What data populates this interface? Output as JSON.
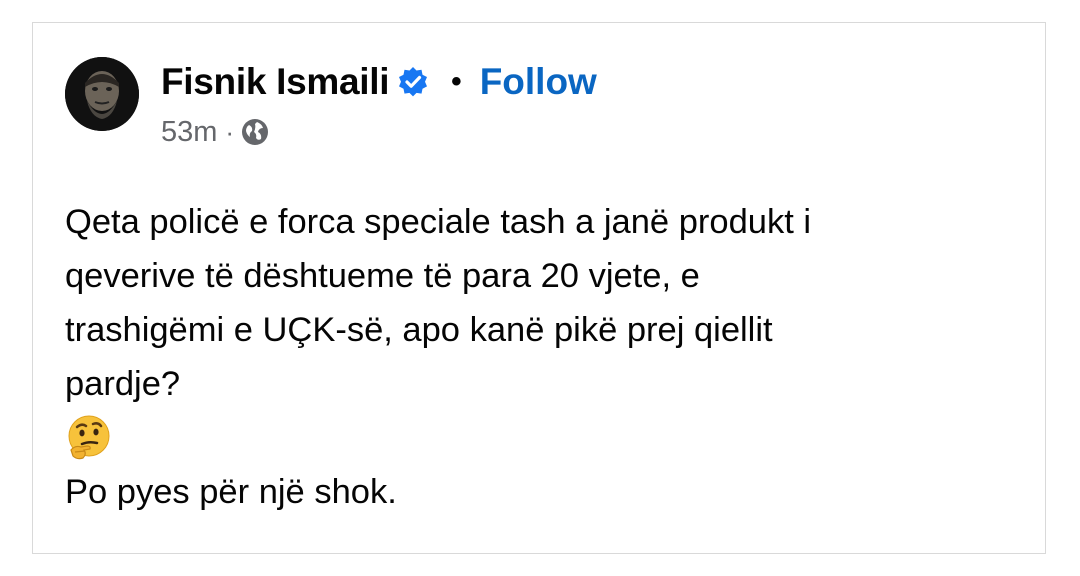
{
  "post": {
    "author_name": "Fisnik Ismaili",
    "follow_label": "Follow",
    "separator_dot": "•",
    "time": "53m",
    "meta_separator": "·",
    "verified_icon": "verified-badge-icon",
    "privacy_icon": "globe-icon",
    "colors": {
      "follow": "#0a66c2",
      "verified": "#1877f2",
      "meta": "#65676b",
      "text": "#050505"
    },
    "text_lines": [
      "Qeta policë e forca speciale tash a janë produkt i",
      "qeverive të dështueme të para 20 vjete, e",
      "trashigëmi e UÇK-së, apo kanë pikë prej qiellit",
      "pardje?"
    ],
    "emoji_icon": "thinking-face-emoji",
    "closing_line": "Po pyes për një shok."
  }
}
